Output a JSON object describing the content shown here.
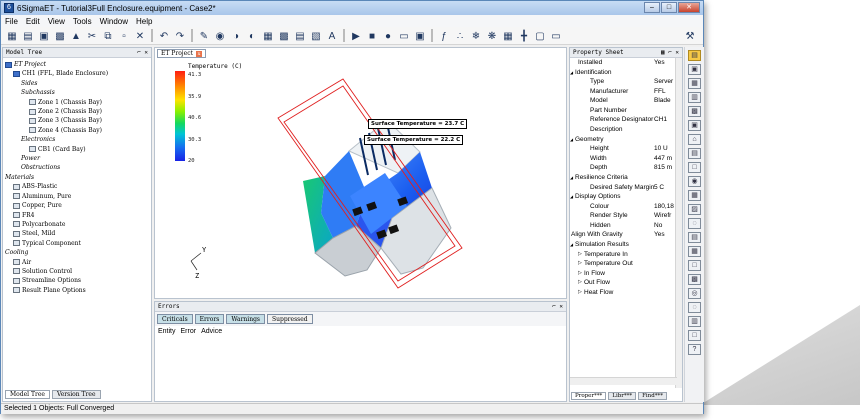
{
  "window": {
    "title": "6SigmaET - Tutorial3Full Enclosure.equipment - Case2*",
    "app_icon": "6sigma-app-icon"
  },
  "menu": [
    "File",
    "Edit",
    "View",
    "Tools",
    "Window",
    "Help"
  ],
  "toolbar_icons": [
    "new-icon",
    "open-icon",
    "save-icon",
    "save-all-icon",
    "model-icon",
    "cut-icon",
    "copy-icon",
    "paste-icon",
    "delete-icon",
    "undo-icon",
    "redo-icon",
    "edit-icon",
    "view-front-icon",
    "view-side-icon",
    "view-top-icon",
    "grid-icon",
    "mesh-icon",
    "solve-icon",
    "results-icon",
    "text-icon",
    "play-icon",
    "stop-icon",
    "record-icon",
    "display-icon",
    "camera-icon",
    "function-icon",
    "particles-icon",
    "snowflake-icon",
    "fan-icon",
    "grid-icon-2",
    "layout-icon",
    "monitor-icon",
    "wrench-icon"
  ],
  "model_tree": {
    "header": "Model Tree",
    "pin": "⌐ ✕",
    "items": [
      {
        "label": "ET Project",
        "indent": 0,
        "icon": "project"
      },
      {
        "label": "CH1 (FFL, Blade Enclosure)",
        "indent": 1,
        "icon": "chassis"
      },
      {
        "label": "Sides",
        "indent": 2,
        "icon": "none"
      },
      {
        "label": "Subchassis",
        "indent": 2,
        "icon": "none"
      },
      {
        "label": "Zone 1 (Chassis Bay)",
        "indent": 3,
        "icon": "zone"
      },
      {
        "label": "Zone 2 (Chassis Bay)",
        "indent": 3,
        "icon": "zone"
      },
      {
        "label": "Zone 3 (Chassis Bay)",
        "indent": 3,
        "icon": "zone"
      },
      {
        "label": "Zone 4 (Chassis Bay)",
        "indent": 3,
        "icon": "zone"
      },
      {
        "label": "Electronics",
        "indent": 2,
        "icon": "none"
      },
      {
        "label": "CB1 (Card Bay)",
        "indent": 3,
        "icon": "zone"
      },
      {
        "label": "Power",
        "indent": 2,
        "icon": "none"
      },
      {
        "label": "Obstructions",
        "indent": 2,
        "icon": "none"
      },
      {
        "label": "Materials",
        "indent": 0,
        "icon": "none"
      },
      {
        "label": "ABS-Plastic",
        "indent": 1,
        "icon": "material"
      },
      {
        "label": "Aluminum, Pure",
        "indent": 1,
        "icon": "material"
      },
      {
        "label": "Copper, Pure",
        "indent": 1,
        "icon": "material"
      },
      {
        "label": "FR4",
        "indent": 1,
        "icon": "material"
      },
      {
        "label": "Polycarbonate",
        "indent": 1,
        "icon": "material"
      },
      {
        "label": "Steel, Mild",
        "indent": 1,
        "icon": "material"
      },
      {
        "label": "Typical Component",
        "indent": 1,
        "icon": "material"
      },
      {
        "label": "Cooling",
        "indent": 0,
        "icon": "none"
      },
      {
        "label": "Air",
        "indent": 1,
        "icon": "air"
      },
      {
        "label": "Solution Control",
        "indent": 1,
        "icon": "control"
      },
      {
        "label": "Streamline Options",
        "indent": 1,
        "icon": "streamline"
      },
      {
        "label": "Result Plane Options",
        "indent": 1,
        "icon": "plane"
      }
    ],
    "tabs": [
      "Model Tree",
      "Version Tree"
    ]
  },
  "viewport": {
    "tab_label": "ET Project",
    "legend_title": "Temperature (C)",
    "legend_ticks": [
      "41.3",
      "35.9",
      "40.6",
      "30.3",
      "20"
    ],
    "annotations": [
      "Surface Temperature = 23.7 C",
      "Surface Temperature = 22.2 C"
    ],
    "axis_labels": [
      "Y",
      "Z"
    ]
  },
  "errors": {
    "header": "Errors",
    "filters": [
      "Criticals",
      "Errors",
      "Warnings",
      "Suppressed"
    ],
    "columns": [
      "Entity",
      "Error",
      "Advice"
    ]
  },
  "property_sheet": {
    "header": "Property Sheet",
    "rows": [
      {
        "k": "Installed",
        "v": "Yes",
        "kind": "row"
      },
      {
        "k": "Identification",
        "v": "",
        "kind": "cat"
      },
      {
        "k": "Type",
        "v": "Server",
        "kind": "sub"
      },
      {
        "k": "Manufacturer",
        "v": "FFL",
        "kind": "sub"
      },
      {
        "k": "Model",
        "v": "Blade",
        "kind": "sub"
      },
      {
        "k": "Part Number",
        "v": "",
        "kind": "sub"
      },
      {
        "k": "Reference Designator",
        "v": "CH1",
        "kind": "sub"
      },
      {
        "k": "Description",
        "v": "",
        "kind": "sub"
      },
      {
        "k": "Geometry",
        "v": "",
        "kind": "cat"
      },
      {
        "k": "Height",
        "v": "10 U",
        "kind": "sub"
      },
      {
        "k": "Width",
        "v": "447 m",
        "kind": "sub"
      },
      {
        "k": "Depth",
        "v": "815 m",
        "kind": "sub"
      },
      {
        "k": "Resilience Criteria",
        "v": "",
        "kind": "cat"
      },
      {
        "k": "Desired Safety Margin",
        "v": "5 C",
        "kind": "sub"
      },
      {
        "k": "Display Options",
        "v": "",
        "kind": "cat"
      },
      {
        "k": "Colour",
        "v": "180,18",
        "kind": "sub"
      },
      {
        "k": "Render Style",
        "v": "Wirefr",
        "kind": "sub"
      },
      {
        "k": "Hidden",
        "v": "No",
        "kind": "sub"
      },
      {
        "k": "Align With Gravity",
        "v": "Yes",
        "kind": "row0"
      },
      {
        "k": "Simulation Results",
        "v": "",
        "kind": "cat"
      },
      {
        "k": "Temperature In",
        "v": "",
        "kind": "res"
      },
      {
        "k": "Temperature Out",
        "v": "",
        "kind": "res"
      },
      {
        "k": "In Flow",
        "v": "",
        "kind": "res"
      },
      {
        "k": "Out Flow",
        "v": "",
        "kind": "res"
      },
      {
        "k": "Heat Flow",
        "v": "",
        "kind": "res"
      }
    ],
    "tabs": [
      "Proper***",
      "Libr***",
      "Find***"
    ]
  },
  "right_toolbar_icons": [
    "layer-icon",
    "cube-icon",
    "panel-icon",
    "rack-icon",
    "unit-icon",
    "server-icon",
    "building-icon",
    "switch-icon",
    "box-icon",
    "circle-icon",
    "grid-icon",
    "dots-icon",
    "sensor-icon",
    "layout-icon",
    "table-icon",
    "page-icon",
    "pdu-icon",
    "ring-icon",
    "globe-icon",
    "signal-icon",
    "monitor-icon",
    "help-icon"
  ],
  "status": "Selected 1 Objects: Full Converged"
}
